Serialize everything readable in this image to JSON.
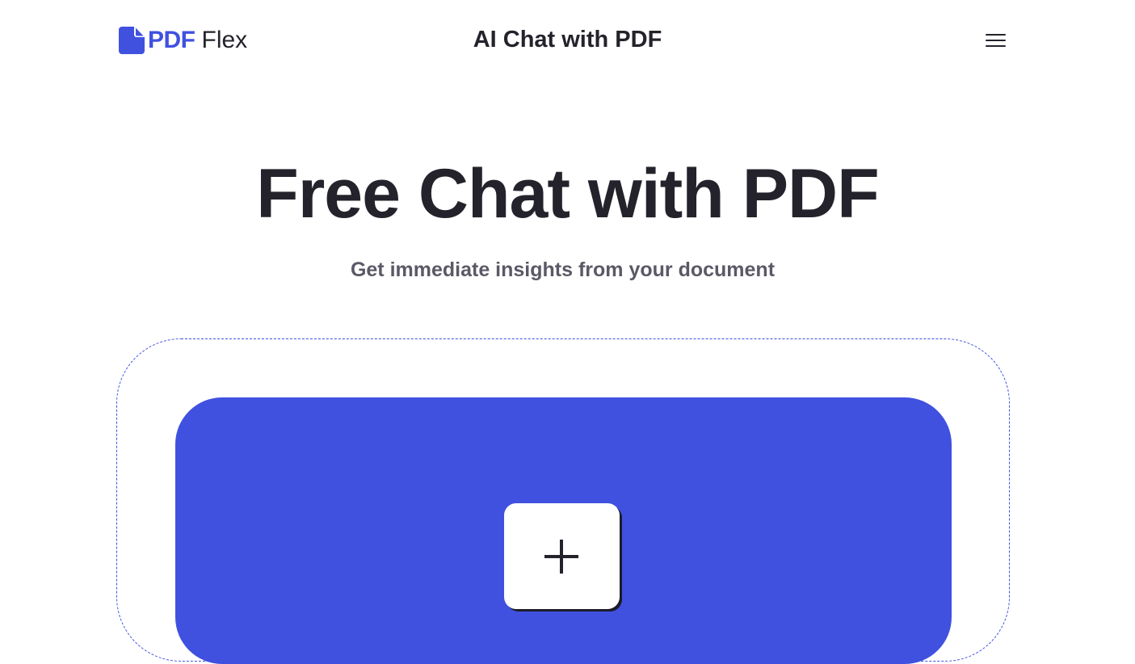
{
  "header": {
    "logo": {
      "brand_part1": "PDF",
      "brand_part2": "Flex",
      "icon": "document-icon"
    },
    "title": "AI Chat with PDF",
    "menu_icon": "hamburger-menu-icon"
  },
  "hero": {
    "title": "Free Chat with PDF",
    "subtitle": "Get immediate insights from your document"
  },
  "upload": {
    "add_icon": "plus-icon"
  },
  "colors": {
    "brand": "#4051e0",
    "text": "#24232c",
    "subtext": "#5a5966",
    "background": "#ffffff"
  }
}
